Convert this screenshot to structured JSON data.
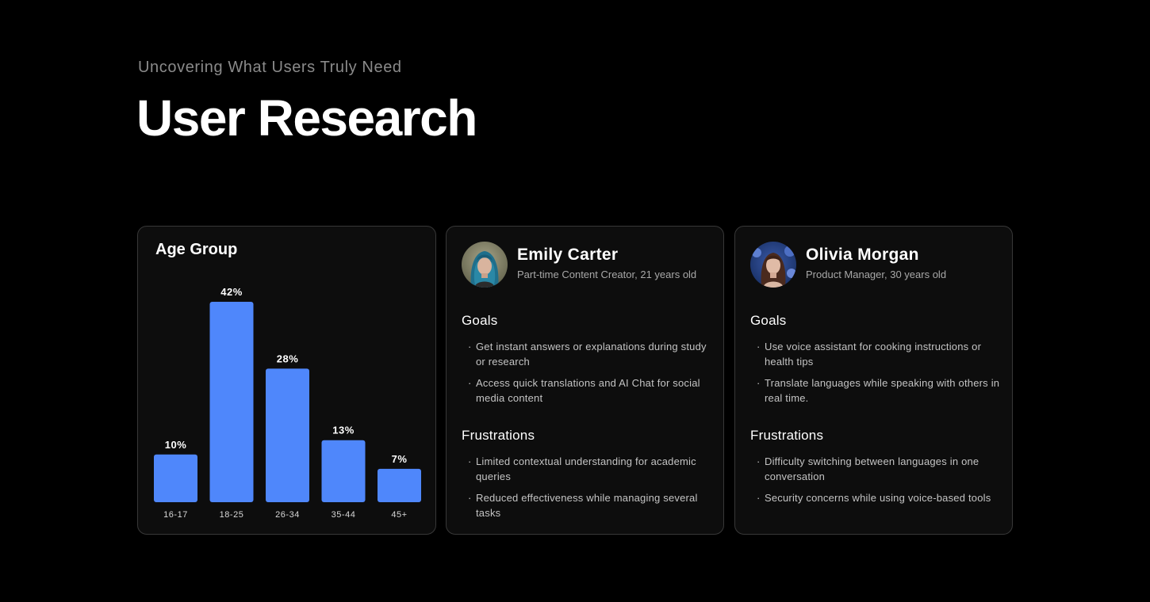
{
  "header": {
    "eyebrow": "Uncovering What Users Truly Need",
    "title": "User Research"
  },
  "chart_card": {
    "title": "Age Group"
  },
  "chart_data": {
    "type": "bar",
    "title": "Age Group",
    "categories": [
      "16-17",
      "18-25",
      "26-34",
      "35-44",
      "45+"
    ],
    "values": [
      10,
      42,
      28,
      13,
      7
    ],
    "value_labels": [
      "10%",
      "42%",
      "28%",
      "13%",
      "7%"
    ],
    "unit": "%",
    "ylim": [
      0,
      42
    ],
    "grid": false,
    "bar_color": "#4f87fb"
  },
  "personas": [
    {
      "name": "Emily Carter",
      "role": "Part-time Content Creator, 21 years old",
      "goals_title": "Goals",
      "goals": [
        "Get instant answers or explanations during study or research",
        "Access quick translations and AI Chat for social media content"
      ],
      "frustrations_title": "Frustrations",
      "frustrations": [
        "Limited contextual understanding for academic queries",
        "Reduced effectiveness while managing several tasks"
      ]
    },
    {
      "name": "Olivia Morgan",
      "role": "Product Manager, 30 years old",
      "goals_title": "Goals",
      "goals": [
        "Use voice assistant for cooking instructions or health tips",
        "Translate languages while speaking with others in real time."
      ],
      "frustrations_title": "Frustrations",
      "frustrations": [
        "Difficulty switching between languages in one conversation",
        "Security concerns while using voice-based tools"
      ]
    }
  ],
  "bullet_glyph": "·",
  "colors": {
    "background": "#000000",
    "card": "#0d0d0d",
    "card_border": "#383838",
    "accent_bar": "#4f87fb"
  }
}
